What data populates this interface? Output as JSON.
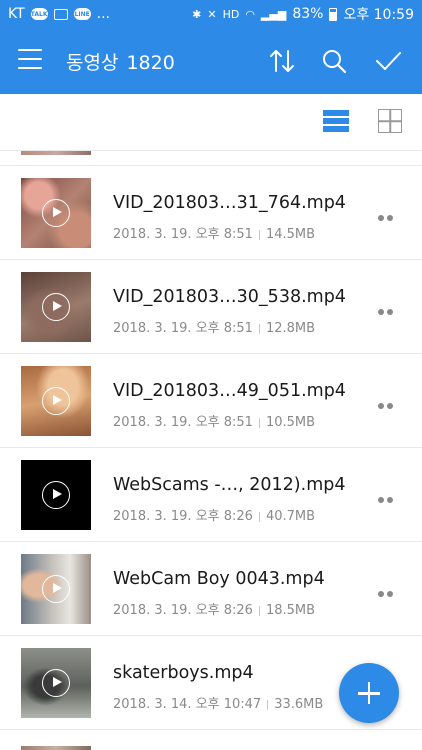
{
  "status_bar": {
    "carrier": "KT",
    "dots": "...",
    "hd": "HD",
    "battery": "83%",
    "time": "오후 10:59",
    "notif_talk": "TALK",
    "notif_line": "LINE"
  },
  "app_bar": {
    "title": "동영상",
    "count": "1820"
  },
  "files": [
    {
      "name": "VID_201803…31_764.mp4",
      "date": "2018. 3. 19. 오후 8:51",
      "size": "14.5MB",
      "thumb": "thumb-1"
    },
    {
      "name": "VID_201803…30_538.mp4",
      "date": "2018. 3. 19. 오후 8:51",
      "size": "12.8MB",
      "thumb": "thumb-2"
    },
    {
      "name": "VID_201803…49_051.mp4",
      "date": "2018. 3. 19. 오후 8:51",
      "size": "10.5MB",
      "thumb": "thumb-3"
    },
    {
      "name": "WebScams -…, 2012).mp4",
      "date": "2018. 3. 19. 오후 8:26",
      "size": "40.7MB",
      "thumb": "thumb-4"
    },
    {
      "name": "WebCam Boy 0043.mp4",
      "date": "2018. 3. 19. 오후 8:26",
      "size": "18.5MB",
      "thumb": "thumb-5"
    },
    {
      "name": "skaterboys.mp4",
      "date": "2018. 3. 14. 오후 10:47",
      "size": "33.6MB",
      "thumb": "thumb-6"
    }
  ],
  "colors": {
    "accent": "#2d8ae6",
    "text_primary": "#1a1a1a",
    "text_secondary": "#8a8a8a"
  },
  "icons": {
    "menu": "menu-icon",
    "sort": "sort-icon",
    "search": "search-icon",
    "select": "check-icon",
    "list_view": "list-view-icon",
    "grid_view": "grid-view-icon",
    "more": "more-icon",
    "play": "play-icon",
    "add": "add-icon"
  }
}
